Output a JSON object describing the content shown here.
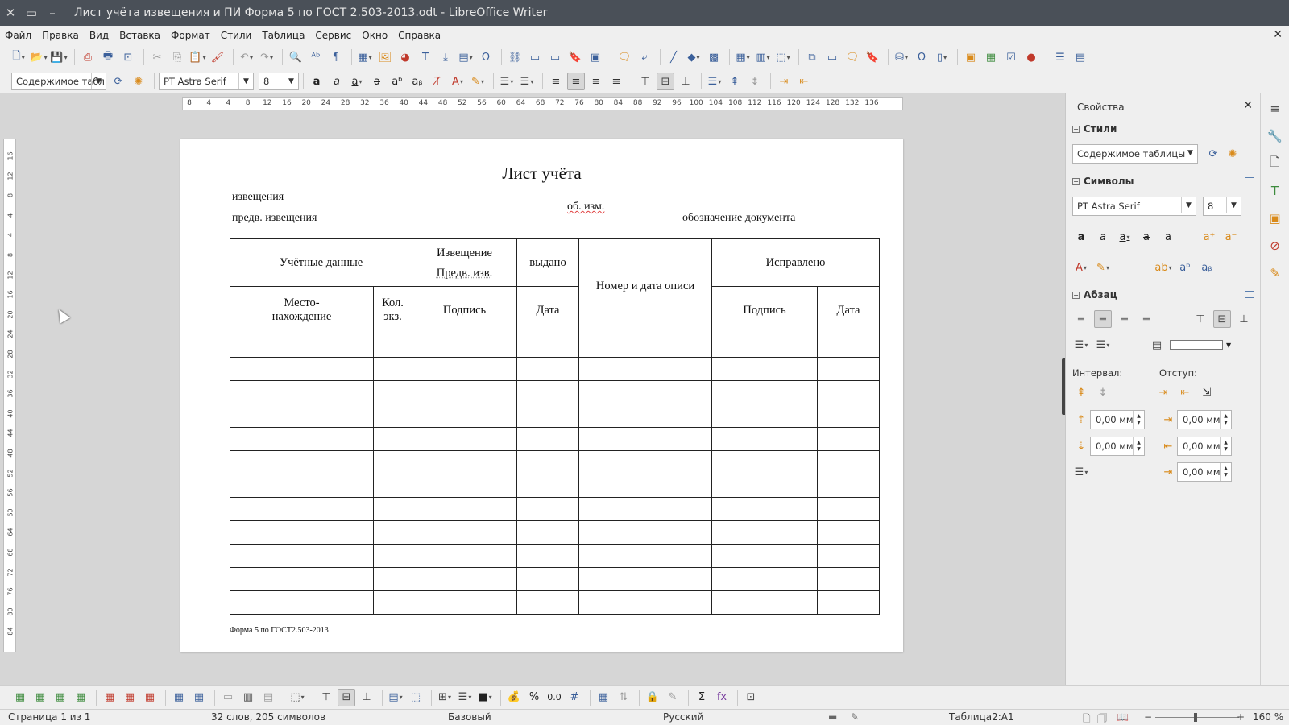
{
  "window": {
    "title": "Лист учёта извещения и ПИ Форма 5 по ГОСТ 2.503-2013.odt - LibreOffice Writer",
    "close_glyph": "✕",
    "maximize_glyph": "▭",
    "minimize_glyph": "–"
  },
  "menu": {
    "items": [
      "Файл",
      "Правка",
      "Вид",
      "Вставка",
      "Формат",
      "Стили",
      "Таблица",
      "Сервис",
      "Окно",
      "Справка"
    ],
    "close_doc_glyph": "✕"
  },
  "formatting": {
    "paragraph_style": "Содержимое табл",
    "font_name": "PT Astra Serif",
    "font_size": "8"
  },
  "ruler": {
    "h_marks": [
      "8",
      "4",
      "4",
      "8",
      "12",
      "16",
      "20",
      "24",
      "28",
      "32",
      "36",
      "40",
      "44",
      "48",
      "52",
      "56",
      "60",
      "64",
      "68",
      "72",
      "76",
      "80",
      "84",
      "88",
      "92",
      "96",
      "100",
      "104",
      "108",
      "112",
      "116",
      "120",
      "124",
      "128",
      "132",
      "136"
    ],
    "v_marks": [
      "16",
      "12",
      "8",
      "4",
      "4",
      "8",
      "12",
      "16",
      "20",
      "24",
      "28",
      "32",
      "36",
      "40",
      "44",
      "48",
      "52",
      "56",
      "60",
      "64",
      "68",
      "72",
      "76",
      "80",
      "84"
    ]
  },
  "document": {
    "title": "Лист учёта",
    "line1_left": "извещения",
    "line1_mid": "об. изм.",
    "line2_left": "предв. извещения",
    "line2_right": "обозначение документа",
    "table": {
      "h_accounting": "Учётные данные",
      "h_notice": "Извещение",
      "h_prelim": "Предв. изв.",
      "h_issued": "выдано",
      "h_inventory": "Номер и дата описи",
      "h_corrected": "Исправлено",
      "h_location": "Место-нахождение",
      "h_copies": "Кол. экз.",
      "h_signature": "Подпись",
      "h_date": "Дата",
      "h_signature2": "Подпись",
      "h_date2": "Дата",
      "empty_rows": 12
    },
    "footnote": "Форма 5 по ГОСТ2.503-2013"
  },
  "sidebar": {
    "title": "Свойства",
    "close_glyph": "✕",
    "styles_section": "Стили",
    "style_value": "Содержимое таблицы",
    "chars_section": "Символы",
    "font_name": "PT Astra Serif",
    "font_size": "8",
    "para_section": "Абзац",
    "spacing_label": "Интервал:",
    "indent_label": "Отступ:",
    "spacing_above": "0,00 мм",
    "spacing_below": "0,00 мм",
    "indent_before": "0,00 мм",
    "indent_after": "0,00 мм",
    "indent_first": "0,00 мм"
  },
  "status": {
    "page": "Страница 1 из 1",
    "words": "32 слов, 205 символов",
    "page_style": "Базовый",
    "language": "Русский",
    "cell": "Таблица2:A1",
    "zoom": "160 %"
  },
  "colors": {
    "titlebar": "#4a5058",
    "toolbar": "#efefef",
    "workspace": "#d6d6d6",
    "icon_blue": "#3a5f9a"
  }
}
